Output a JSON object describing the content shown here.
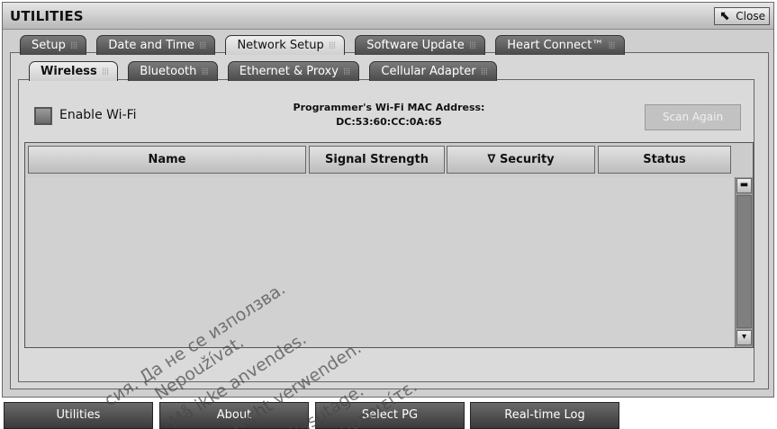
{
  "window": {
    "title": "UTILITIES",
    "close_label": "Close",
    "close_icon": "cursor-arrow-icon"
  },
  "main_tabs": [
    {
      "label": "Setup",
      "active": false
    },
    {
      "label": "Date and Time",
      "active": false
    },
    {
      "label": "Network Setup",
      "active": true
    },
    {
      "label": "Software Update",
      "active": false
    },
    {
      "label": "Heart Connect™",
      "active": false
    }
  ],
  "sub_tabs": [
    {
      "label": "Wireless",
      "active": true
    },
    {
      "label": "Bluetooth",
      "active": false
    },
    {
      "label": "Ethernet & Proxy",
      "active": false
    },
    {
      "label": "Cellular Adapter",
      "active": false
    }
  ],
  "wifi": {
    "enable_label": "Enable Wi-Fi",
    "enabled": false,
    "mac_title": "Programmer's Wi-Fi MAC Address:",
    "mac_value": "DC:53:60:CC:0A:65",
    "scan_label": "Scan Again",
    "scan_enabled": false
  },
  "table": {
    "columns": [
      {
        "label": "Name"
      },
      {
        "label": "Signal Strength"
      },
      {
        "label": "∇ Security"
      },
      {
        "label": "Status"
      }
    ],
    "rows": []
  },
  "bottom_nav": [
    {
      "label": "Utilities"
    },
    {
      "label": "About"
    },
    {
      "label": "Select PG"
    },
    {
      "label": "Real-time Log"
    }
  ],
  "watermarks": [
    "сия. Да не се използва.",
    "Nepoužívat.",
    "Må ikke anvendes.",
    "Nicht verwenden.",
    "kasutage.",
    "ιμοποιείτε."
  ]
}
